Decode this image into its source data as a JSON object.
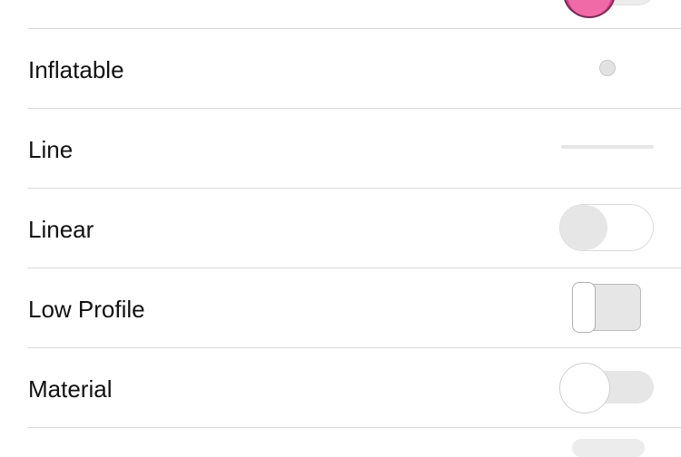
{
  "settings_list": {
    "rows": [
      {
        "label": "Inflatable",
        "control": "inflatable-toggle",
        "state": "off"
      },
      {
        "label": "Line",
        "control": "line-toggle",
        "state": "off"
      },
      {
        "label": "Linear",
        "control": "linear-toggle",
        "state": "off"
      },
      {
        "label": "Low Profile",
        "control": "low-profile-toggle",
        "state": "off"
      },
      {
        "label": "Material",
        "control": "material-toggle",
        "state": "off"
      }
    ]
  },
  "colors": {
    "background": "#ffffff",
    "separator": "#d9d9d9",
    "text": "#111111",
    "toggle_off_gray": "#e6e6e6",
    "donut_pink": "#f06aa8"
  },
  "icons": {
    "top_partial_toggle_knob": "donut-icon"
  }
}
